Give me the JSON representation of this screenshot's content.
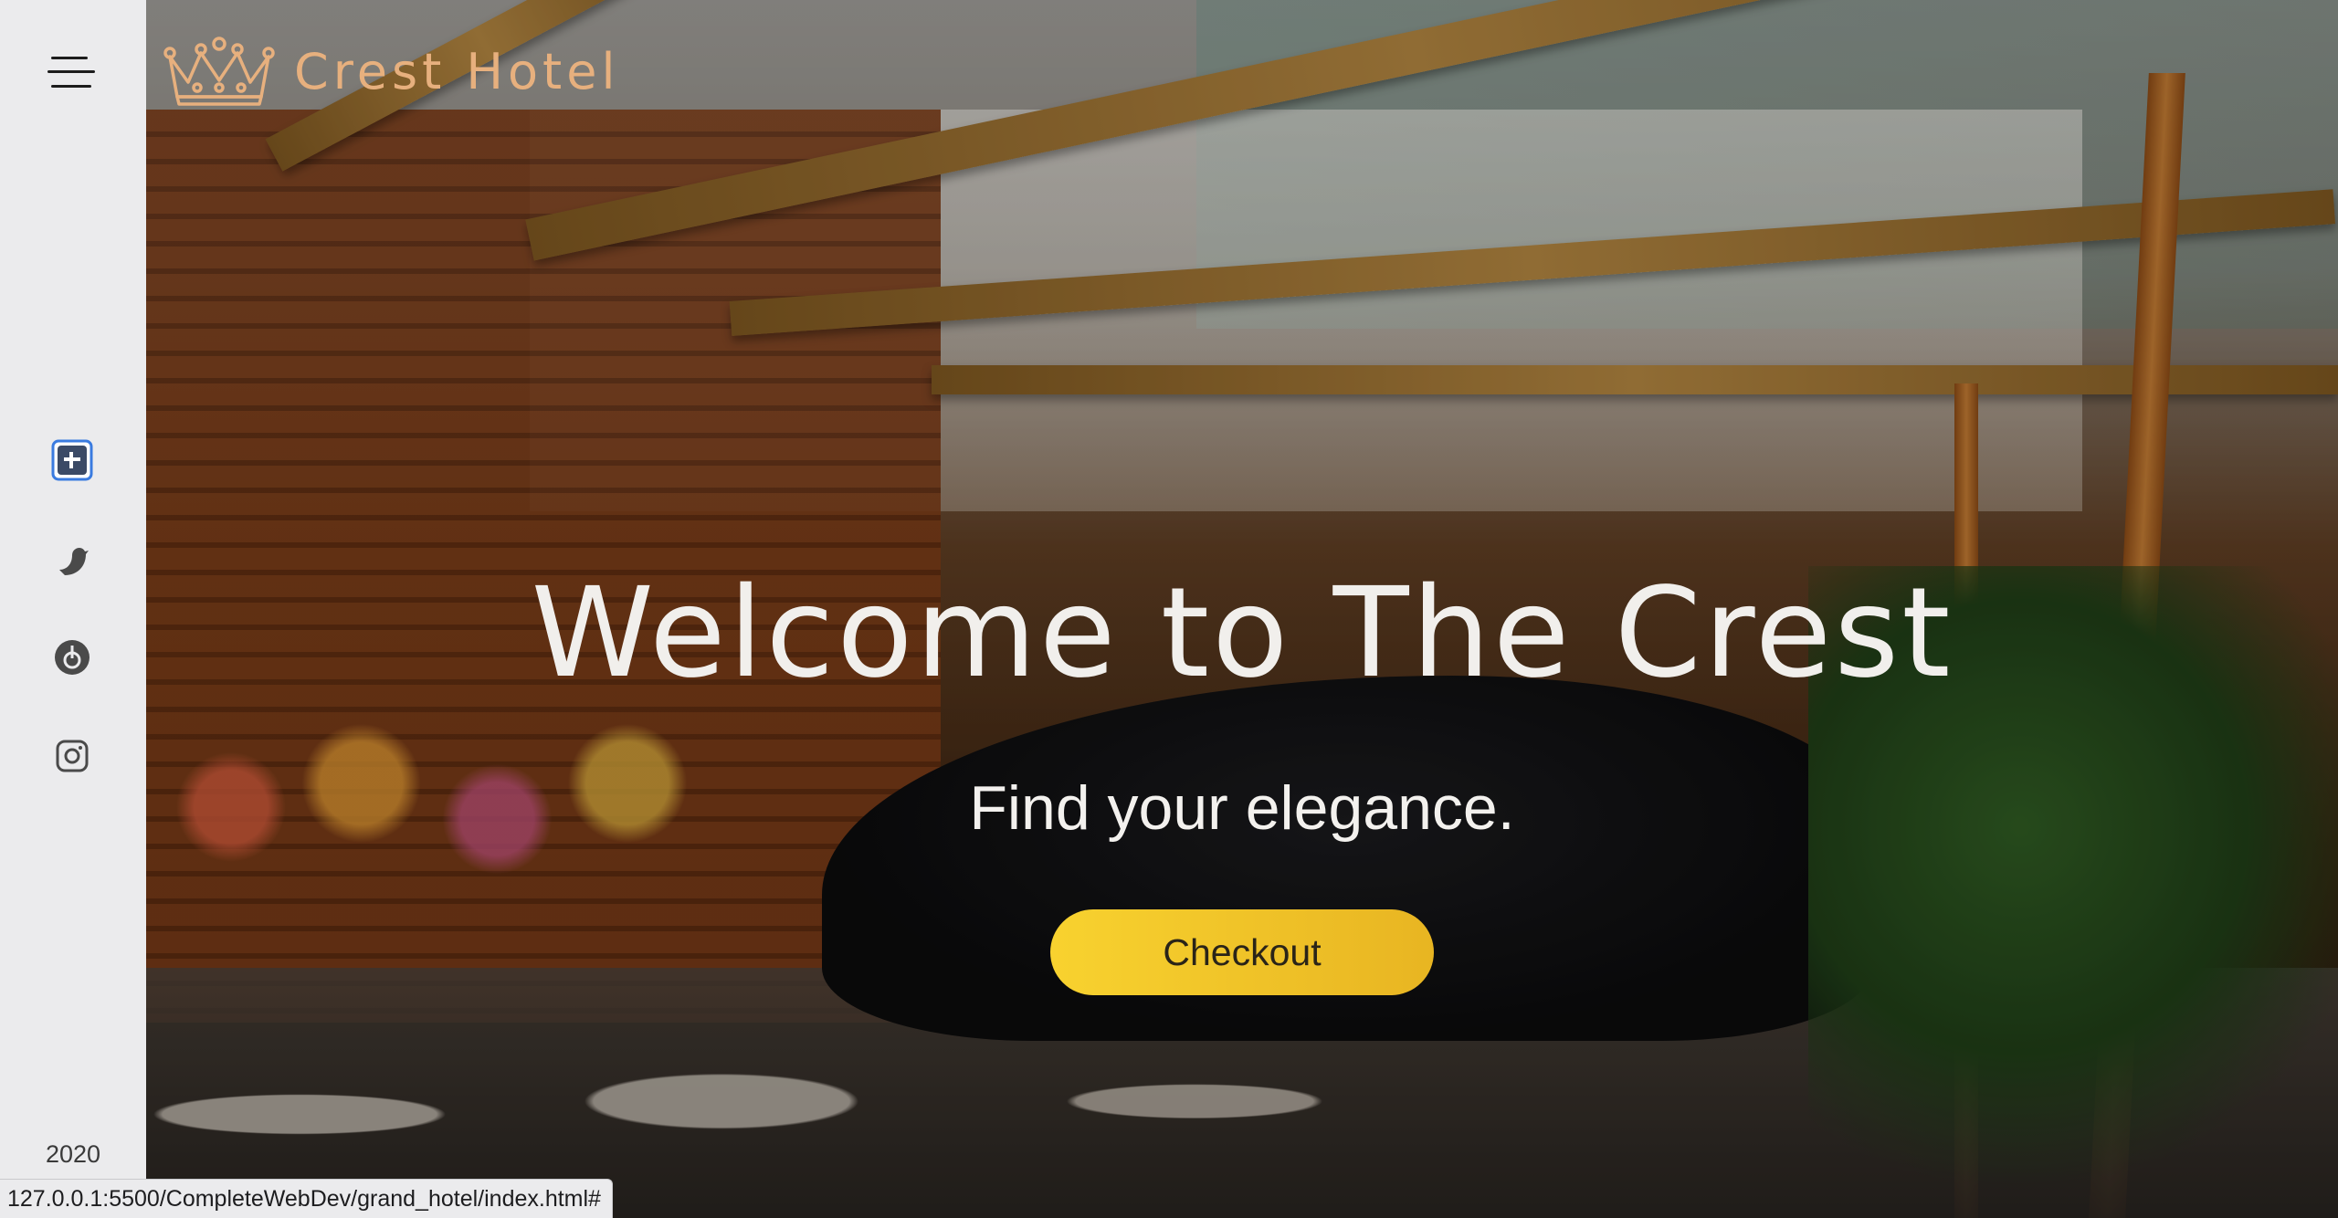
{
  "brand": {
    "name": "Crest Hotel",
    "logo_icon": "crown-icon",
    "color": "#e7b07e"
  },
  "sidebar": {
    "menu_icon": "hamburger-menu-icon",
    "social": [
      {
        "name": "facebook-icon"
      },
      {
        "name": "twitter-icon"
      },
      {
        "name": "github-icon"
      },
      {
        "name": "instagram-icon"
      }
    ],
    "year": "2020"
  },
  "hero": {
    "title": "Welcome to The Crest",
    "subtitle": "Find your elegance.",
    "cta_label": "Checkout",
    "cta_color": "#f8d22f"
  },
  "status_bar": {
    "url": "127.0.0.1:5500/CompleteWebDev/grand_hotel/index.html#"
  }
}
